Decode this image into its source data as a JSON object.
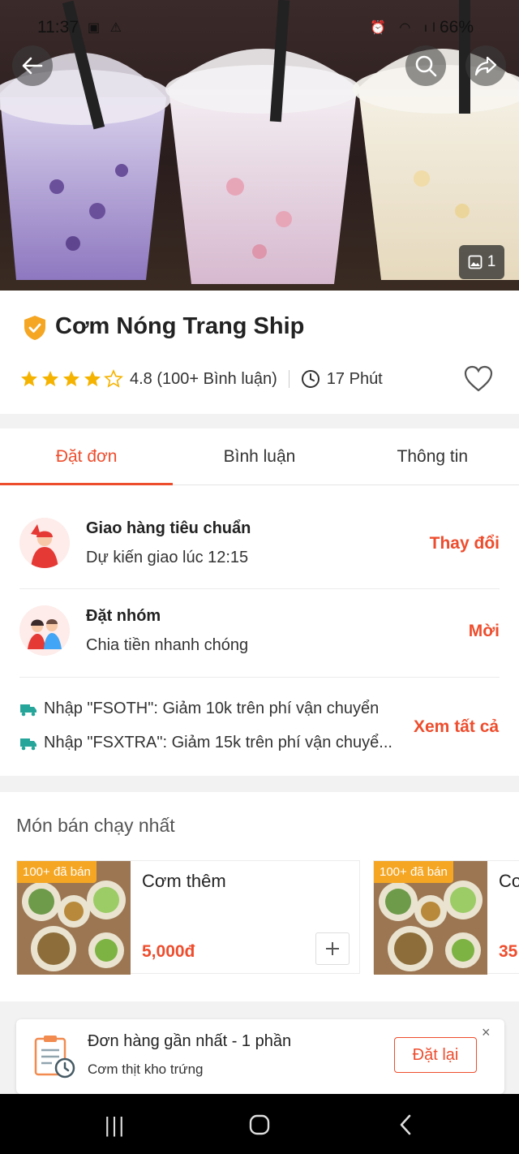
{
  "status_bar": {
    "time": "11:37",
    "battery": "66%",
    "left_icons": "▣ ⚠",
    "right_icons": "⏰ ◠ ıl"
  },
  "hero": {
    "image_count": "1"
  },
  "store": {
    "name": "Cơm Nóng Trang Ship",
    "rating": 4.8,
    "rating_text": "4.8 (100+ Bình luận)",
    "time_text": "17 Phút"
  },
  "tabs": [
    {
      "label": "Đặt đơn",
      "active": true
    },
    {
      "label": "Bình luận",
      "active": false
    },
    {
      "label": "Thông tin",
      "active": false
    }
  ],
  "delivery": {
    "standard": {
      "title": "Giao hàng tiêu chuẩn",
      "subtitle": "Dự kiến giao lúc 12:15",
      "action": "Thay đổi"
    },
    "group": {
      "title": "Đặt nhóm",
      "subtitle": "Chia tiền nhanh chóng",
      "action": "Mời"
    }
  },
  "promos": [
    "Nhập \"FSOTH\": Giảm 10k trên phí vận chuyển",
    "Nhập \"FSXTRA\": Giảm 15k trên phí vận chuyể..."
  ],
  "promos_action": "Xem tất cả",
  "best_sellers": {
    "title": "Món bán chạy nhất",
    "items": [
      {
        "badge": "100+ đã bán",
        "name": "Cơm thêm",
        "price": "5,000đ"
      },
      {
        "badge": "100+ đã bán",
        "name": "Cơm",
        "price": "35"
      }
    ]
  },
  "recent_order": {
    "title": "Đơn hàng gần nhất - 1 phần",
    "subtitle": "Cơm thịt kho trứng",
    "action": "Đặt lại",
    "close": "×"
  },
  "nav_bar": {
    "recents": "|||"
  },
  "colors": {
    "accent": "#ee4d2d",
    "star": "#f5b301",
    "badge": "#f5a623"
  },
  "icons": [
    "back-arrow-icon",
    "search-icon",
    "share-icon",
    "image-icon",
    "verified-shield-icon",
    "star-icon",
    "clock-icon",
    "heart-icon",
    "truck-icon",
    "plus-icon",
    "order-clipboard-icon",
    "close-icon",
    "recents-icon",
    "home-icon",
    "back-nav-icon"
  ]
}
